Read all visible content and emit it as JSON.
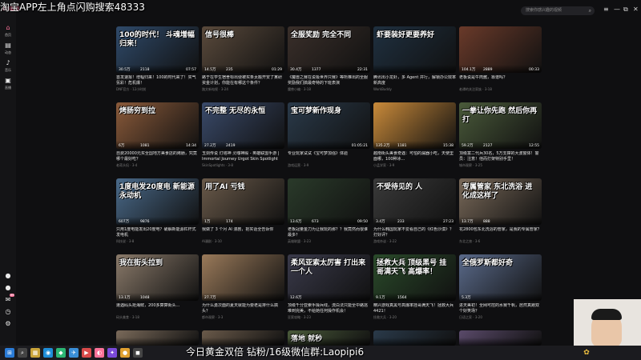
{
  "overlay": {
    "top_text": "淘宝APP左上角点闪购搜索48333",
    "bottom_text": "今日黄金双倍 钻粉/16级微信群:Laopipi6"
  },
  "app": {
    "logo": "bilibili",
    "search_placeholder": "搜索你感兴趣的视频",
    "sidebar": [
      {
        "icon": "home-icon",
        "glyph": "⌂",
        "label": "首页"
      },
      {
        "icon": "dynamic-icon",
        "glyph": "▤",
        "label": "动态"
      },
      {
        "icon": "music-icon",
        "glyph": "♪",
        "label": "音乐"
      },
      {
        "icon": "live-icon",
        "glyph": "▣",
        "label": "直播"
      }
    ],
    "sidebar_bottom": [
      {
        "icon": "avatar-icon",
        "glyph": "●"
      },
      {
        "icon": "avatar2-icon",
        "glyph": "●"
      },
      {
        "icon": "message-icon",
        "glyph": "✉",
        "badge": "99"
      },
      {
        "icon": "history-icon",
        "glyph": "◷"
      },
      {
        "icon": "settings-icon",
        "glyph": "⚙"
      }
    ]
  },
  "cards": [
    {
      "thumb_text": "100的时代！ 斗魂增幅归来！",
      "bg": "#2f4a6a",
      "views": "30.5万",
      "danmaku": "2118",
      "duration": "07:57",
      "title": "首发速报！增幅归来！100的时代来了！买气氛彩！危机爆！",
      "meta": "DNF官方 · 12小时前"
    },
    {
      "thumb_text": "信号很棒",
      "bg": "#5a4a3c",
      "views": "14.5万",
      "danmaku": "235",
      "duration": "01:29",
      "title": "路于在学生宿舍标出便被买条太搬开安了某研资金计划，你能在有哪这个条件？",
      "meta": "路文新电视 · 3-24"
    },
    {
      "thumb_text": "全服奖励 完全不同",
      "bg": "#3a2f2a",
      "views": "30.4万",
      "danmaku": "1377",
      "duration": "22:31",
      "title": "《魔兽之赛在说极世界只赛》等所推出的全服奖励我们搞最奇特的下班表演",
      "meta": "魔兽小编 · 3-18"
    },
    {
      "thumb_text": "虾要装好更要养好",
      "bg": "#1f3040",
      "views": "",
      "danmaku": "",
      "duration": "",
      "title": "腾讯出小龙虾，多 Agent 并行，解锁办公效率新高度",
      "meta": "WorkBuddy"
    },
    {
      "thumb_text": "",
      "bg": "#6a3a2a",
      "views": "104.1万",
      "danmaku": "2889",
      "duration": "00:33",
      "title": "老板说是牛肉酱，靠谱吗？",
      "meta": "老谭的关注家族 · 3-18"
    },
    {
      "thumb_text": "烤肠穷到拉",
      "bg": "#8a5a3a",
      "views": "6万",
      "danmaku": "1081",
      "duration": "14:34",
      "title": "自费20000元买全国地方美食店的烤肠，究竟哪个最好吃？",
      "meta": "老蒋头侃 · 3-4"
    },
    {
      "thumb_text": "不完整 无尽的永恒",
      "bg": "#3a4a6a",
      "views": "27.2万",
      "danmaku": "2419",
      "duration": "",
      "title": "玉剑传说 灯塔神 灵魂神殿 - 英雄联盟手游 | Immortal Journey Urgot Skin Spotlight",
      "meta": "SkinSpotlights · 3-8"
    },
    {
      "thumb_text": "宝可梦新作现身",
      "bg": "#2a3a4a",
      "views": "",
      "danmaku": "",
      "duration": "01:05:21",
      "title": "专业玩家试试《宝可梦加强》体验",
      "meta": "游戏运营 · 3-9"
    },
    {
      "thumb_text": "",
      "bg": "#c98a3a",
      "views": "135.2万",
      "danmaku": "1181",
      "duration": "15:38",
      "title": "越南街头美食奇遇：可怕的漏器小吃，天使里面哪，100种冰...",
      "meta": "小孟学家 · 3-9"
    },
    {
      "thumb_text": "一拳让你先跑 然后你再打",
      "bg": "#4a5a3a",
      "views": "59.2万",
      "danmaku": "2127",
      "duration": "12:55",
      "title": "顶级富二代兵30名，5万支撑的大波窗体！警员：注意！他而打架特别手里！",
      "meta": "城市观察 · 3-25"
    },
    {
      "thumb_text": "1度电发20度电 新能源永动机",
      "bg": "#4a6a8a",
      "views": "607万",
      "danmaku": "9876",
      "duration": "",
      "title": "只用1度电能发出20度电？破解新能源杠杆式发电机",
      "meta": "科技说 · 3-8"
    },
    {
      "thumb_text": "用了AI 亏钱",
      "bg": "#6a5a4a",
      "views": "1万",
      "danmaku": "174",
      "duration": "",
      "title": "我做了 3 个月 AI 漫剧，把实话全告诉你",
      "meta": "AI漫剧 · 3-10"
    },
    {
      "thumb_text": "",
      "bg": "#2a3a2a",
      "views": "13.6万",
      "danmaku": "673",
      "duration": "09:50",
      "title": "老板冠量金刀为让我玩的那？？我竟然而很谁最多？",
      "meta": "英雄联盟 · 3-23"
    },
    {
      "thumb_text": "不受待见的 人",
      "bg": "#3a3a3a",
      "views": "3.4万",
      "danmaku": "233",
      "duration": "27:23",
      "title": "为什么韩国玩家不爱看自己的《红色沙漠》？打好评？",
      "meta": "游戏杂谈 · 3-22"
    },
    {
      "thumb_text": "专属管家 东北洗浴 进化成这样了",
      "bg": "#7a6a5a",
      "views": "13.7万",
      "danmaku": "888",
      "duration": "",
      "title": "花2800包东北洗浴的管家，是我的专属管家？",
      "meta": "东北之旅 · 3-6"
    },
    {
      "thumb_text": "我在街头拉到",
      "bg": "#8a7a6a",
      "views": "13.1万",
      "danmaku": "1048",
      "duration": "",
      "title": "遭遇码头抢海鲜，200多算算街头...",
      "meta": "码头美食 · 3-18"
    },
    {
      "thumb_text": "",
      "bg": "#9a7a5a",
      "views": "27.7万",
      "danmaku": "",
      "duration": "",
      "title": "为什么勇次面的夏天就能为要老是排什么搞头？",
      "meta": "都市观察 · 3-3"
    },
    {
      "thumb_text": "柔风亚索太厉害 打出来一个人",
      "bg": "#3a3a4a",
      "views": "12.6万",
      "danmaku": "",
      "duration": "",
      "title": "顶级千分亚索手操兵线，流白法只能全中路逃难到完美，不给她任何操作机会！",
      "meta": "亚索攻略 · 3-23"
    },
    {
      "thumb_text": "拯救大兵 顶级黑号 挂哥满天飞 高爆率！",
      "bg": "#2a4a2a",
      "views": "9.1万",
      "danmaku": "1564",
      "duration": "",
      "title": "精兴游戏真黑号高爆率挂哥满天飞！拯救大兵4421！",
      "meta": "拯救大兵 · 3-20"
    },
    {
      "thumb_text": "全俄罗斯都好奇",
      "bg": "#5a6a8a",
      "views": "5.3万",
      "danmaku": "",
      "duration": "",
      "title": "进天美初！全网可控的水赛千帆，居然真跑双个好笑场？",
      "meta": "日语之家 · 3-20"
    },
    {
      "thumb_text": "",
      "bg": "#7a6a5a",
      "views": "",
      "danmaku": "",
      "duration": "",
      "title": "",
      "meta": ""
    },
    {
      "thumb_text": "",
      "bg": "#6a5a4a",
      "views": "",
      "danmaku": "",
      "duration": "",
      "title": "",
      "meta": ""
    },
    {
      "thumb_text": "落地 就秒",
      "bg": "#4a5a3a",
      "views": "",
      "danmaku": "",
      "duration": "",
      "title": "",
      "meta": ""
    },
    {
      "thumb_text": "",
      "bg": "#2a3a4a",
      "views": "",
      "danmaku": "",
      "duration": "",
      "title": "",
      "meta": ""
    },
    {
      "thumb_text": "",
      "bg": "#5a4a6a",
      "views": "",
      "danmaku": "",
      "duration": "",
      "title": "",
      "meta": ""
    }
  ],
  "taskbar": [
    {
      "icon": "windows-icon",
      "glyph": "⊞",
      "color": "#2a7bd6"
    },
    {
      "icon": "search-icon",
      "glyph": "⌕",
      "color": "#444"
    },
    {
      "icon": "files-icon",
      "glyph": "▦",
      "color": "#c9a43a"
    },
    {
      "icon": "browser-icon",
      "glyph": "◉",
      "color": "#1f8ed8"
    },
    {
      "icon": "chat-icon",
      "glyph": "◆",
      "color": "#2bb673"
    },
    {
      "icon": "store-icon",
      "glyph": "✈",
      "color": "#3a8fd8"
    },
    {
      "icon": "media-icon",
      "glyph": "▶",
      "color": "#d94a4a"
    },
    {
      "icon": "bilibili-icon",
      "glyph": "◐",
      "color": "#fb7299"
    },
    {
      "icon": "game-icon",
      "glyph": "✦",
      "color": "#7a4ad8"
    },
    {
      "icon": "app-icon",
      "glyph": "●",
      "color": "#e0a030"
    },
    {
      "icon": "app2-icon",
      "glyph": "◼",
      "color": "#444"
    }
  ]
}
